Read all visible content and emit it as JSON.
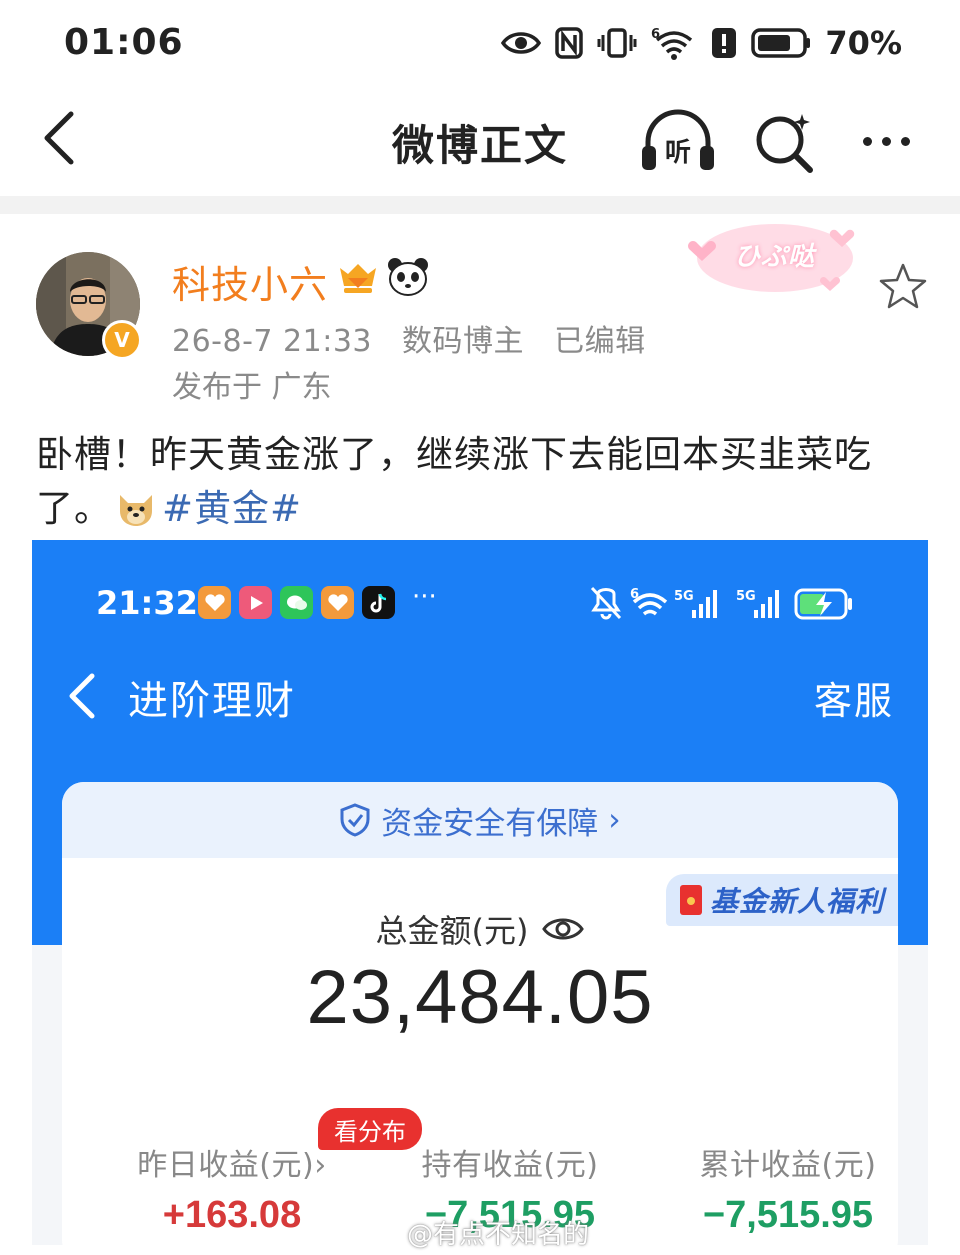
{
  "status_bar": {
    "time": "01:06",
    "battery": "70%",
    "network_label": "6"
  },
  "header": {
    "title": "微博正文",
    "listen_label": "听"
  },
  "post": {
    "author": "科技小六",
    "verified_badge": "V",
    "date": "26-8-7 21:33",
    "role": "数码博主",
    "edited": "已编辑",
    "location": "发布于 广东",
    "decoration_text": "ひぷ哒",
    "text_before": "卧槽！昨天黄金涨了，继续涨下去能回本买韭菜吃了。",
    "hashtag": "#黄金#"
  },
  "screenshot": {
    "status": {
      "time": "21:32",
      "more": "···"
    },
    "title": "进阶理财",
    "service": "客服",
    "safety_text": "资金安全有保障",
    "safety_chevron": "›",
    "newbie_tag": "基金新人福利",
    "total_label": "总金额(元)",
    "total_value": "23,484.05",
    "distribution_button": "看分布",
    "stats": [
      {
        "label": "昨日收益(元)",
        "chevron": "›",
        "value": "+163.08"
      },
      {
        "label": "持有收益(元)",
        "value": "−7,515.95"
      },
      {
        "label": "累计收益(元)",
        "value": "−7,515.95"
      }
    ]
  },
  "watermark": "@有点不知名的",
  "colors": {
    "accent_orange": "#f27e1e",
    "hashtag_blue": "#3b6ab3",
    "app_blue": "#1b7ff6",
    "gain_red": "#d63a3a",
    "loss_green": "#1e9e63"
  }
}
